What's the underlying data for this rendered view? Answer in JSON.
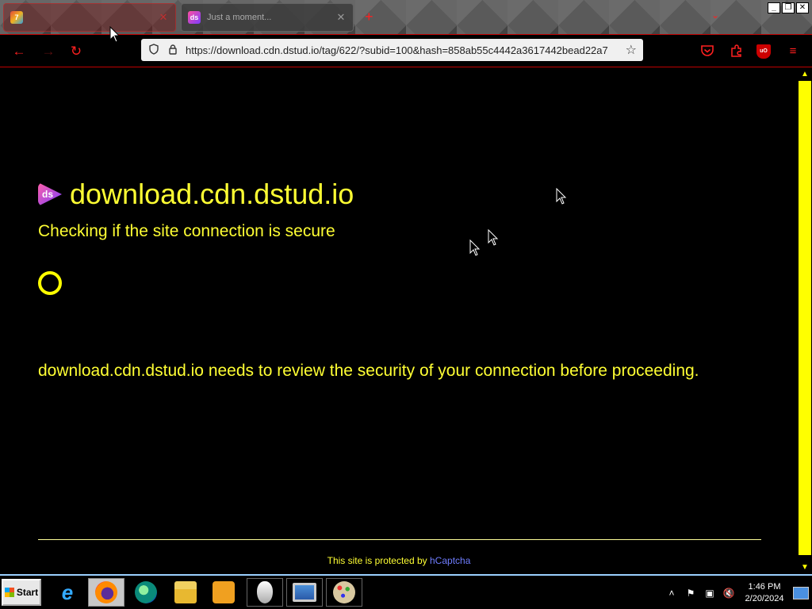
{
  "browser": {
    "tabs": [
      {
        "title": "",
        "favicon": "zenith-favicon",
        "active": true
      },
      {
        "title": "Just a moment...",
        "favicon": "dstud-favicon",
        "active": false
      }
    ],
    "new_tab_symbol": "+",
    "tab_list_symbol": "⌄",
    "window_controls": {
      "minimize": "_",
      "restore": "❐",
      "close": "✕"
    },
    "nav": {
      "back": "←",
      "forward": "→",
      "reload": "↻"
    },
    "url": "https://download.cdn.dstud.io/tag/622/?subid=100&hash=858ab55c4442a3617442bead22a7",
    "toolbar_icons": [
      "shield-icon",
      "lock-icon",
      "star-icon",
      "pocket-icon",
      "extensions-icon",
      "ublock-icon",
      "menu-icon"
    ]
  },
  "page": {
    "logo_text": "ds",
    "site_name": "download.cdn.dstud.io",
    "checking": "Checking if the site connection is secure",
    "review": "download.cdn.dstud.io needs to review the security of your connection before proceeding.",
    "footer_prefix": "This site is protected by ",
    "footer_link": "hCaptcha"
  },
  "taskbar": {
    "start_label": "Start",
    "apps": [
      "internet-explorer",
      "firefox",
      "edge",
      "file-explorer",
      "media-player",
      "mouse-settings",
      "display-settings",
      "paint"
    ],
    "clock_time": "1:46 PM",
    "clock_date": "2/20/2024"
  },
  "colors": {
    "page_text": "#ffff33",
    "link": "#6f7dff",
    "accent_red": "#ff2020",
    "scroll_thumb": "#ffff00"
  }
}
